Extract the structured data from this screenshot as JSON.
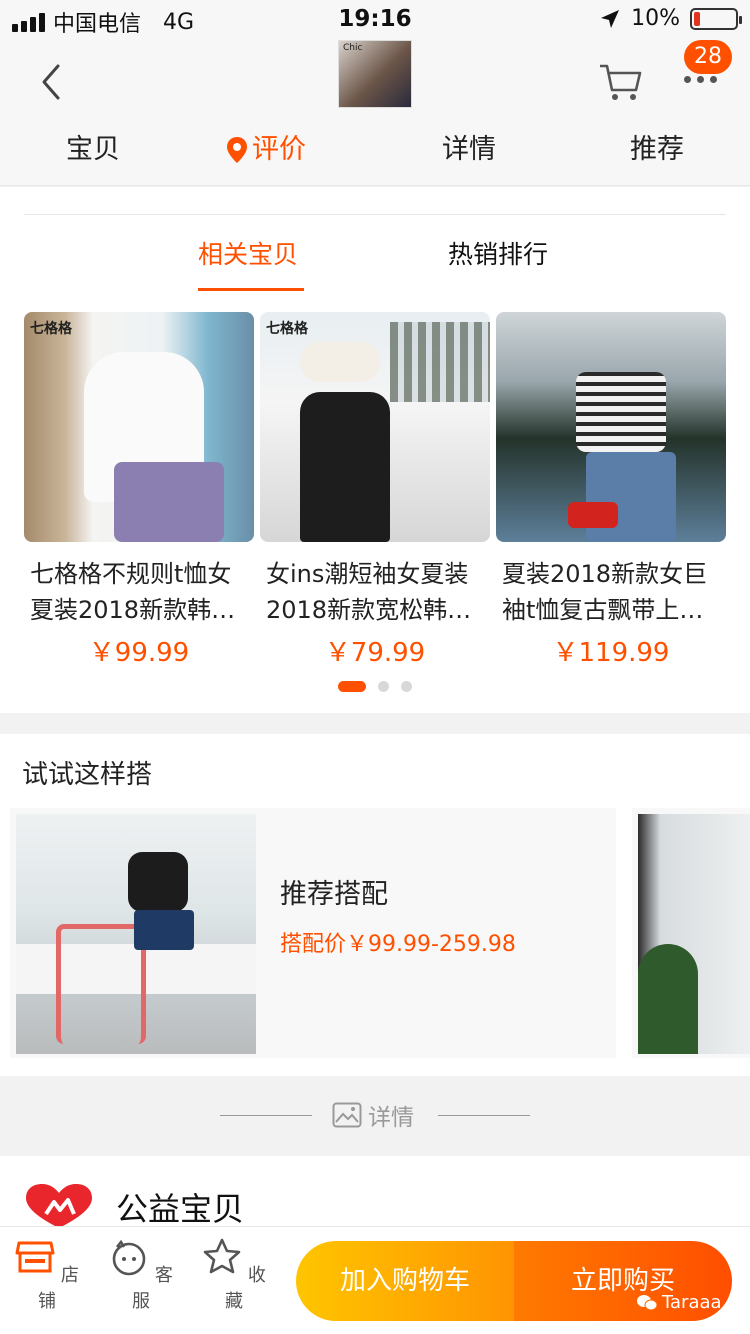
{
  "status_bar": {
    "carrier": "中国电信",
    "network": "4G",
    "time": "19:16",
    "battery": "10%"
  },
  "header": {
    "cart_badge": "28",
    "tabs": [
      "宝贝",
      "评价",
      "详情",
      "推荐"
    ],
    "active_tab": "评价",
    "thumb_caption": "Chic"
  },
  "related": {
    "tabs": [
      "相关宝贝",
      "热销排行"
    ],
    "products": [
      {
        "brand": "七格格",
        "name": "七格格不规则t恤女夏装2018新款韩…",
        "price": "￥99.99"
      },
      {
        "brand": "七格格",
        "name": "女ins潮短袖女夏装2018新款宽松韩…",
        "price": "￥79.99"
      },
      {
        "brand": "",
        "name": "夏装2018新款女巨袖t恤复古飘带上…",
        "price": "￥119.99"
      }
    ]
  },
  "outfit": {
    "title": "试试这样搭",
    "card_title": "推荐搭配",
    "card_price": "搭配价￥99.99-259.98"
  },
  "detail_divider": "详情",
  "charity": "公益宝贝",
  "bottom": {
    "shop": "店铺",
    "service": "客服",
    "favorite": "收藏",
    "add_cart": "加入购物车",
    "buy_now": "立即购买",
    "watermark": "Taraaa"
  },
  "colors": {
    "accent": "#ff5000",
    "cart_button": "#ffa200",
    "buy_button": "#ff5000"
  }
}
